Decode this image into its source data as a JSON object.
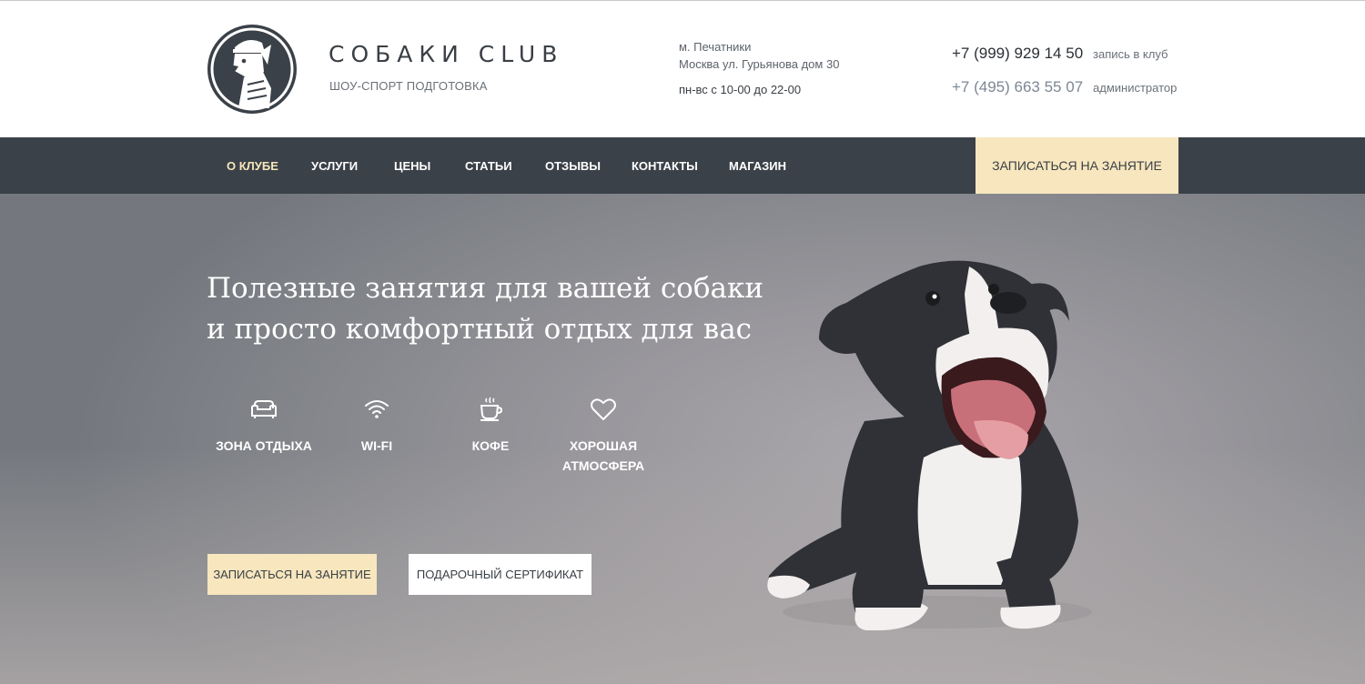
{
  "header": {
    "logo_icon": "dog-in-cap-logo",
    "brand_title": "СОБАКИ CLUB",
    "brand_subtitle": "ШОУ-СПОРТ ПОДГОТОВКА",
    "address_line1": "м. Печатники",
    "address_line2": "Москва ул. Гурьянова дом 30",
    "hours": "пн-вс с 10-00 до 22-00",
    "phone1": "+7 (999) 929 14 50",
    "phone1_note": "запись в клуб",
    "phone2": "+7 (495) 663 55 07",
    "phone2_note": "администратор"
  },
  "nav": {
    "items": [
      {
        "label": "О КЛУБЕ",
        "active": true
      },
      {
        "label": "УСЛУГИ"
      },
      {
        "label": "ЦЕНЫ"
      },
      {
        "label": "СТАТЬИ"
      },
      {
        "label": "ОТЗЫВЫ"
      },
      {
        "label": "КОНТАКТЫ"
      },
      {
        "label": "МАГАЗИН"
      }
    ],
    "cta": "ЗАПИСАТЬСЯ НА ЗАНЯТИЕ"
  },
  "hero": {
    "title_line1": "Полезные занятия для вашей собаки",
    "title_line2": "и просто комфортный отдых для вас",
    "features": [
      {
        "icon": "sofa-icon",
        "label": "ЗОНА ОТДЫХА"
      },
      {
        "icon": "wifi-icon",
        "label": "WI-FI"
      },
      {
        "icon": "coffee-cup-icon",
        "label": "КОФЕ"
      },
      {
        "icon": "heart-icon",
        "label": "ХОРОШАЯ АТМОСФЕРА"
      }
    ],
    "primary_button": "ЗАПИСАТЬСЯ НА ЗАНЯТИЕ",
    "secondary_button": "ПОДАРОЧНЫЙ СЕРТИФИКАТ",
    "image": "dog-puppy-photo"
  },
  "colors": {
    "dark": "#3b4148",
    "accent": "#f7e6be",
    "nav_active": "#f7e6b9"
  }
}
